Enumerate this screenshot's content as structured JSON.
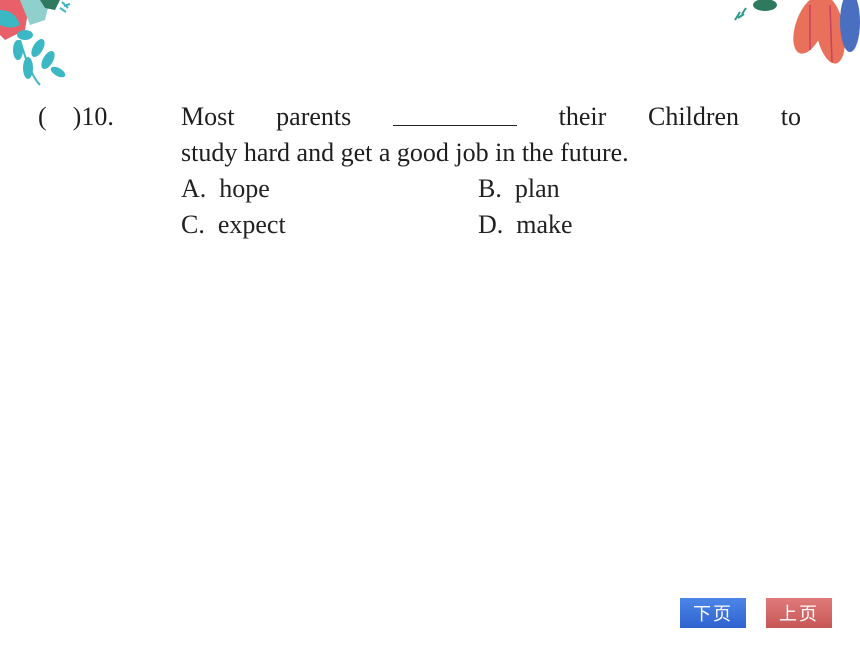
{
  "question": {
    "number_prefix": "(    )10.",
    "line1_words": [
      "Most",
      "parents",
      "their",
      "Children",
      "to"
    ],
    "line2": "study hard and get a good job in the future.",
    "options": [
      {
        "label": "A.",
        "text": "hope"
      },
      {
        "label": "B.",
        "text": "plan"
      },
      {
        "label": "C.",
        "text": "expect"
      },
      {
        "label": "D.",
        "text": "make"
      }
    ]
  },
  "nav": {
    "next_label": "下页",
    "prev_label": "上页"
  },
  "colors": {
    "next_button": "#3a6fdc",
    "prev_button": "#d46565"
  }
}
